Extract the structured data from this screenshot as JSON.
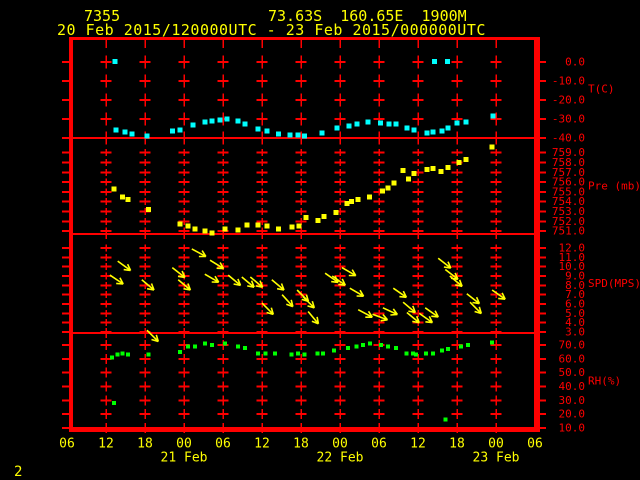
{
  "header": {
    "station_id": "7355",
    "location": "73.63S  160.65E  1900M",
    "time_range": "20 Feb 2015/120000UTC - 23 Feb 2015/000000UTC"
  },
  "page_number": "2",
  "colors": {
    "background": "#000000",
    "axis": "#ff0000",
    "label_yellow": "#ffff00",
    "temperature": "#00ffff",
    "pressure": "#ffff00",
    "wind": "#ffff00",
    "humidity": "#00ff00"
  },
  "chart_data": {
    "type": "scatter",
    "t_unit": "hours after first x tick (06UTC 20 Feb 2015)",
    "x_axis": {
      "range": [
        0,
        72
      ],
      "tick_t": [
        0,
        6,
        12,
        18,
        24,
        30,
        36,
        42,
        48,
        54,
        60,
        66,
        72
      ],
      "tick_labels": [
        "06",
        "12",
        "18",
        "00",
        "06",
        "12",
        "18",
        "00",
        "06",
        "12",
        "18",
        "00",
        "06"
      ],
      "day_labels": [
        {
          "t": 18,
          "label": "21 Feb"
        },
        {
          "t": 42,
          "label": "22 Feb"
        },
        {
          "t": 66,
          "label": "23 Feb"
        }
      ],
      "grid_t": [
        6,
        12,
        18,
        24,
        30,
        36,
        42,
        48,
        54,
        60,
        66
      ]
    },
    "panels": [
      {
        "id": "temperature",
        "ylabel": "T(C)",
        "ylim": [
          11.6,
          -40.0
        ],
        "ytick_values": [
          0,
          -10,
          -20,
          -30,
          -40
        ],
        "ytick_labels": [
          "0.0",
          "-10.0",
          "-20.0",
          "-30.0",
          "-40.0"
        ],
        "marker": "square",
        "color": "#00ffff",
        "points": [
          [
            7.4,
            0.4
          ],
          [
            7.5,
            -35.8
          ],
          [
            8.9,
            -36.8
          ],
          [
            10.0,
            -37.9
          ],
          [
            12.3,
            -38.9
          ],
          [
            16.2,
            -36.3
          ],
          [
            17.4,
            -35.8
          ],
          [
            19.4,
            -33.2
          ],
          [
            21.2,
            -31.6
          ],
          [
            22.3,
            -31.1
          ],
          [
            23.5,
            -30.5
          ],
          [
            24.6,
            -30.0
          ],
          [
            26.3,
            -31.1
          ],
          [
            27.4,
            -32.6
          ],
          [
            29.4,
            -35.3
          ],
          [
            30.8,
            -36.3
          ],
          [
            32.5,
            -37.9
          ],
          [
            34.3,
            -38.4
          ],
          [
            35.5,
            -38.4
          ],
          [
            36.5,
            -38.9
          ],
          [
            39.2,
            -37.4
          ],
          [
            41.5,
            -34.7
          ],
          [
            43.4,
            -33.7
          ],
          [
            44.6,
            -32.6
          ],
          [
            46.3,
            -31.6
          ],
          [
            48.2,
            -32.1
          ],
          [
            49.5,
            -32.6
          ],
          [
            50.6,
            -32.6
          ],
          [
            52.3,
            -34.7
          ],
          [
            53.4,
            -35.8
          ],
          [
            55.4,
            -37.4
          ],
          [
            56.3,
            -36.8
          ],
          [
            56.5,
            0.4
          ],
          [
            57.7,
            -36.3
          ],
          [
            58.5,
            0.4
          ],
          [
            58.6,
            -34.7
          ],
          [
            60.0,
            -32.1
          ],
          [
            61.4,
            -31.6
          ],
          [
            65.5,
            -28.4
          ]
        ]
      },
      {
        "id": "pressure",
        "ylabel": "Pre (mb)",
        "ylim": [
          760.5,
          750.7
        ],
        "ytick_values": [
          759,
          758,
          757,
          756,
          755,
          754,
          753,
          752,
          751
        ],
        "ytick_labels": [
          "759.0",
          "758.0",
          "757.0",
          "756.0",
          "755.0",
          "754.0",
          "753.0",
          "752.0",
          "751.0"
        ],
        "marker": "square",
        "color": "#ffff00",
        "points": [
          [
            7.2,
            755.3
          ],
          [
            8.5,
            754.5
          ],
          [
            9.4,
            754.2
          ],
          [
            12.5,
            753.2
          ],
          [
            17.4,
            751.7
          ],
          [
            18.6,
            751.5
          ],
          [
            19.7,
            751.2
          ],
          [
            21.2,
            751.0
          ],
          [
            22.3,
            750.8
          ],
          [
            24.3,
            751.2
          ],
          [
            26.3,
            751.1
          ],
          [
            27.7,
            751.6
          ],
          [
            29.4,
            751.6
          ],
          [
            30.8,
            751.5
          ],
          [
            32.5,
            751.2
          ],
          [
            34.6,
            751.4
          ],
          [
            35.7,
            751.5
          ],
          [
            36.8,
            752.4
          ],
          [
            38.6,
            752.1
          ],
          [
            39.5,
            752.5
          ],
          [
            41.4,
            752.9
          ],
          [
            43.1,
            753.8
          ],
          [
            43.8,
            754.0
          ],
          [
            44.8,
            754.2
          ],
          [
            46.5,
            754.5
          ],
          [
            48.5,
            755.1
          ],
          [
            49.4,
            755.4
          ],
          [
            50.3,
            755.9
          ],
          [
            51.7,
            757.2
          ],
          [
            52.5,
            756.3
          ],
          [
            53.4,
            756.9
          ],
          [
            55.4,
            757.3
          ],
          [
            56.3,
            757.4
          ],
          [
            57.5,
            757.1
          ],
          [
            58.6,
            757.5
          ],
          [
            60.3,
            758.0
          ],
          [
            61.4,
            758.3
          ],
          [
            65.4,
            759.6
          ]
        ]
      },
      {
        "id": "wind_speed",
        "ylabel": "SPD(MPS)",
        "ylim": [
          13.5,
          2.9
        ],
        "ytick_values": [
          12,
          11,
          10,
          9,
          8,
          7,
          6,
          5,
          4,
          3
        ],
        "ytick_labels": [
          "12.0",
          "11.0",
          "10.0",
          "9.0",
          "8.0",
          "7.0",
          "6.0",
          "5.0",
          "4.0",
          "3.0"
        ],
        "marker": "arrow",
        "angle_note": "degrees clockwise from screen-right",
        "color": "#ffff00",
        "points": [
          [
            6.6,
            9.1,
            34
          ],
          [
            7.8,
            10.6,
            36
          ],
          [
            11.5,
            8.6,
            40
          ],
          [
            12.3,
            3.2,
            45
          ],
          [
            16.2,
            9.9,
            38
          ],
          [
            17.1,
            8.6,
            40
          ],
          [
            19.2,
            11.9,
            28
          ],
          [
            21.2,
            9.2,
            30
          ],
          [
            22.0,
            10.7,
            32
          ],
          [
            24.8,
            9.1,
            40
          ],
          [
            26.9,
            8.9,
            40
          ],
          [
            28.2,
            8.9,
            40
          ],
          [
            30.0,
            6.1,
            45
          ],
          [
            31.5,
            8.6,
            40
          ],
          [
            33.1,
            7.0,
            48
          ],
          [
            35.4,
            7.5,
            45
          ],
          [
            36.3,
            6.8,
            45
          ],
          [
            37.1,
            5.2,
            50
          ],
          [
            39.7,
            9.3,
            35
          ],
          [
            40.8,
            9.0,
            35
          ],
          [
            42.3,
            9.9,
            30
          ],
          [
            43.5,
            7.7,
            30
          ],
          [
            44.8,
            5.4,
            28
          ],
          [
            47.0,
            4.9,
            20
          ],
          [
            48.6,
            5.6,
            25
          ],
          [
            50.2,
            7.7,
            35
          ],
          [
            51.7,
            6.2,
            40
          ],
          [
            52.3,
            5.1,
            40
          ],
          [
            54.2,
            5.0,
            35
          ],
          [
            55.1,
            5.6,
            35
          ],
          [
            57.1,
            10.9,
            38
          ],
          [
            58.2,
            9.7,
            38
          ],
          [
            58.9,
            9.0,
            40
          ],
          [
            61.5,
            7.1,
            38
          ],
          [
            62.0,
            6.2,
            45
          ],
          [
            65.4,
            7.5,
            35
          ]
        ]
      },
      {
        "id": "relative_humidity",
        "ylabel": "RH(%)",
        "ylim": [
          78.7,
          9.3
        ],
        "ytick_values": [
          70,
          60,
          50,
          40,
          30,
          20,
          10
        ],
        "ytick_labels": [
          "70.0",
          "60.0",
          "50.0",
          "40.0",
          "30.0",
          "20.0",
          "10.0"
        ],
        "marker": "square",
        "color": "#00ff00",
        "points": [
          [
            6.9,
            61
          ],
          [
            7.2,
            28
          ],
          [
            7.8,
            63
          ],
          [
            8.5,
            64
          ],
          [
            9.4,
            63
          ],
          [
            12.5,
            63
          ],
          [
            17.4,
            65
          ],
          [
            18.6,
            69
          ],
          [
            19.7,
            69
          ],
          [
            21.2,
            71
          ],
          [
            22.3,
            70
          ],
          [
            24.3,
            71
          ],
          [
            26.3,
            69
          ],
          [
            27.4,
            68
          ],
          [
            29.4,
            64
          ],
          [
            30.5,
            64
          ],
          [
            32.0,
            64
          ],
          [
            34.5,
            63
          ],
          [
            35.5,
            64
          ],
          [
            36.5,
            63
          ],
          [
            38.5,
            64
          ],
          [
            39.4,
            64
          ],
          [
            41.1,
            66
          ],
          [
            43.2,
            68
          ],
          [
            44.5,
            69
          ],
          [
            45.5,
            70
          ],
          [
            46.6,
            71
          ],
          [
            48.3,
            70
          ],
          [
            49.4,
            69
          ],
          [
            50.6,
            68
          ],
          [
            52.2,
            64
          ],
          [
            53.2,
            64
          ],
          [
            53.7,
            63
          ],
          [
            55.2,
            64
          ],
          [
            56.3,
            64
          ],
          [
            57.7,
            66
          ],
          [
            58.2,
            16
          ],
          [
            58.6,
            67
          ],
          [
            60.6,
            69
          ],
          [
            61.7,
            70
          ],
          [
            65.4,
            72
          ]
        ]
      }
    ]
  }
}
